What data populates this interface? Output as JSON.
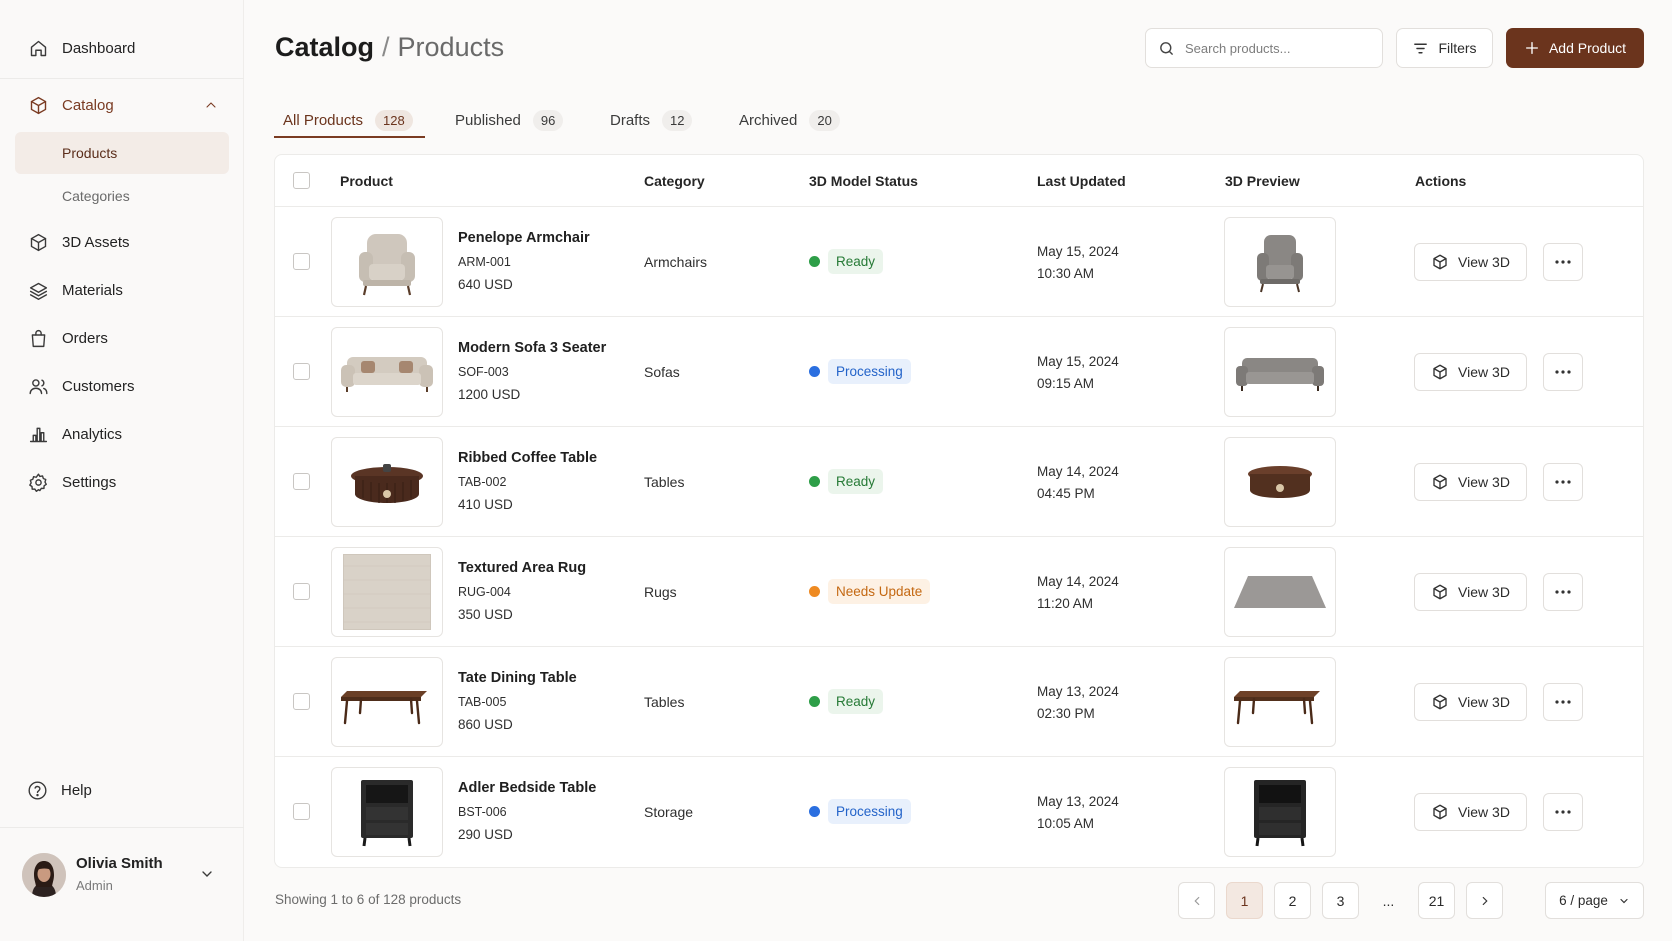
{
  "sidebar": {
    "dashboard": "Dashboard",
    "catalog": "Catalog",
    "products": "Products",
    "categories": "Categories",
    "assets": "3D Assets",
    "materials": "Materials",
    "orders": "Orders",
    "customers": "Customers",
    "analytics": "Analytics",
    "settings": "Settings",
    "help": "Help",
    "user": {
      "name": "Olivia Smith",
      "role": "Admin"
    }
  },
  "header": {
    "title": "Catalog",
    "separator": "/",
    "subtitle": "Products",
    "search_placeholder": "Search products...",
    "filters_label": "Filters",
    "add_label": "Add Product"
  },
  "tabs": [
    {
      "label": "All Products",
      "count": "128"
    },
    {
      "label": "Published",
      "count": "96"
    },
    {
      "label": "Drafts",
      "count": "12"
    },
    {
      "label": "Archived",
      "count": "20"
    }
  ],
  "table": {
    "headers": {
      "product": "Product",
      "category": "Category",
      "status": "3D Model Status",
      "updated": "Last Updated",
      "preview": "3D Preview",
      "actions": "Actions"
    },
    "view3d_label": "View 3D",
    "rows": [
      {
        "name": "Penelope Armchair",
        "sku": "ARM-001",
        "price": "640 USD",
        "category": "Armchairs",
        "status": "Ready",
        "date": "May 15, 2024",
        "time": "10:30 AM"
      },
      {
        "name": "Modern Sofa 3 Seater",
        "sku": "SOF-003",
        "price": "1200 USD",
        "category": "Sofas",
        "status": "Processing",
        "date": "May 15, 2024",
        "time": "09:15 AM"
      },
      {
        "name": "Ribbed Coffee Table",
        "sku": "TAB-002",
        "price": "410 USD",
        "category": "Tables",
        "status": "Ready",
        "date": "May 14, 2024",
        "time": "04:45 PM"
      },
      {
        "name": "Textured Area Rug",
        "sku": "RUG-004",
        "price": "350 USD",
        "category": "Rugs",
        "status": "Needs Update",
        "date": "May 14, 2024",
        "time": "11:20 AM"
      },
      {
        "name": "Tate Dining Table",
        "sku": "TAB-005",
        "price": "860 USD",
        "category": "Tables",
        "status": "Ready",
        "date": "May 13, 2024",
        "time": "02:30 PM"
      },
      {
        "name": "Adler Bedside Table",
        "sku": "BST-006",
        "price": "290 USD",
        "category": "Storage",
        "status": "Processing",
        "date": "May 13, 2024",
        "time": "10:05 AM"
      }
    ]
  },
  "footer": {
    "showing": "Showing 1 to 6 of 128 products",
    "pages": [
      "1",
      "2",
      "3",
      "...",
      "21"
    ],
    "per_page": "6 / page"
  },
  "colors": {
    "accent": "#6b341d",
    "ready": "#2e9e48",
    "processing": "#2b6fe0",
    "needs_update": "#ee8a22"
  }
}
